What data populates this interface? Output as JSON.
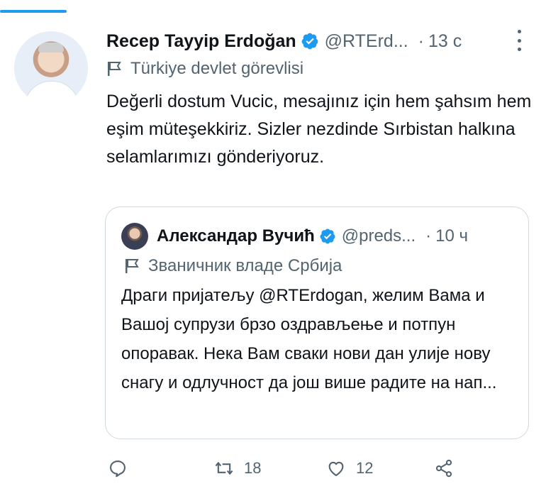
{
  "tweet": {
    "author_name": "Recep Tayyip Erdoğan",
    "author_handle": "@RTErd...",
    "separator": "·",
    "time": "13 c",
    "label": "Türkiye devlet görevlisi",
    "text": "Değerli dostum Vucic, mesajınız için hem şahsım hem eşim müteşekkiriz. Sizler nezdinde Sırbistan halkına selamlarımızı gönderiyoruz."
  },
  "quote": {
    "author_name": "Александар Вучић",
    "author_handle": "@preds...",
    "separator": "·",
    "time": "10 ч",
    "label": "Званичник владе Србија",
    "text": "Драги пријатељу @RTErdogan, желим Вама и Вашој супрузи брзо оздрављење и потпун опоравак. Нека Вам сваки нови дан улије нову снагу и одлучност да још више радите на нап..."
  },
  "actions": {
    "retweets": "18",
    "likes": "12"
  },
  "colors": {
    "accent": "#1d9bf0",
    "muted": "#536471",
    "border": "#cfd9de"
  }
}
